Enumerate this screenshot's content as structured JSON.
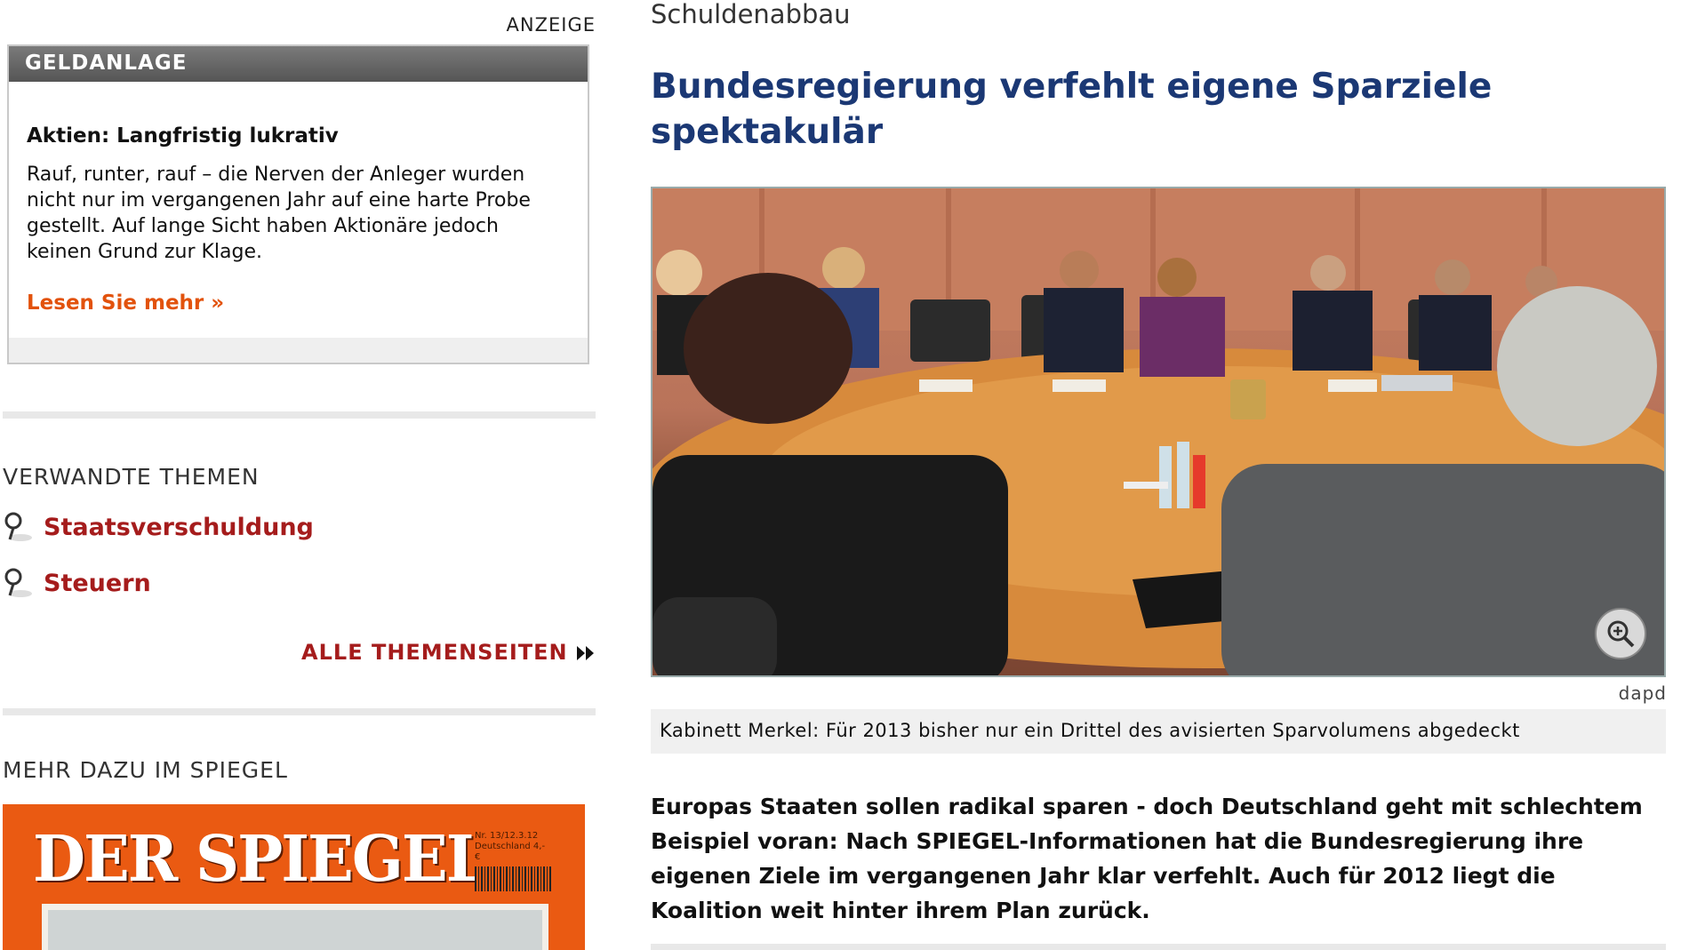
{
  "ad": {
    "label": "ANZEIGE",
    "category": "GELDANLAGE",
    "title": "Aktien: Langfristig lukrativ",
    "text": "Rauf, runter, rauf – die Nerven der Anleger wurden nicht nur im vergangenen Jahr auf eine harte Probe gestellt. Auf lange Sicht haben Aktionäre jedoch keinen Grund zur Klage.",
    "more_link": "Lesen Sie mehr »",
    "accent_color": "#e2520c"
  },
  "related": {
    "heading": "VERWANDTE THEMEN",
    "topics": [
      {
        "label": "Staatsverschuldung",
        "icon": "pin-icon"
      },
      {
        "label": "Steuern",
        "icon": "pin-icon"
      }
    ],
    "all_topics_link": "ALLE THEMENSEITEN",
    "link_color": "#a51c1c"
  },
  "spiegel": {
    "heading": "MEHR DAZU IM SPIEGEL",
    "cover_logo": "DER SPIEGEL",
    "cover_meta": "Nr. 13/12.3.12 Deutschland 4,- €",
    "cover_color": "#ea5a12"
  },
  "article": {
    "kicker": "Schuldenabbau",
    "headline": "Bundesregierung verfehlt eigene Sparziele spektakulär",
    "headline_color": "#1b3874",
    "photo_credit": "dapd",
    "caption": "Kabinett Merkel: Für 2013 bisher nur ein Drittel des avisierten Sparvolumens abgedeckt",
    "lead": "Europas Staaten sollen radikal sparen - doch Deutschland geht mit schlechtem Beispiel voran: Nach SPIEGEL-Informationen hat die Bundesregierung ihre eigenen Ziele im vergangenen Jahr klar verfehlt. Auch für 2012 liegt die Koalition weit hinter ihrem Plan zurück."
  }
}
